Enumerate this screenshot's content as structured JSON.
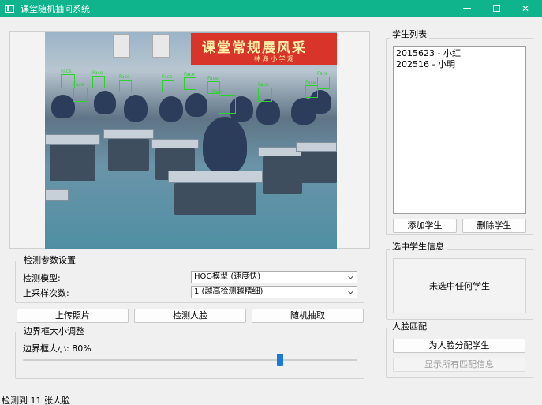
{
  "window": {
    "title": "课堂随机抽问系统",
    "accent": "#10b48c"
  },
  "image_banner": {
    "title": "课堂常规展风采",
    "subtitle": "林 海 小 学 观"
  },
  "face_label": "Face",
  "params": {
    "group_title": "检测参数设置",
    "model_label": "检测模型:",
    "model_value": "HOG模型 (速度快)",
    "upsample_label": "上采样次数:",
    "upsample_value": "1 (越高检测越精细)"
  },
  "actions": {
    "upload": "上传照片",
    "detect": "检测人脸",
    "random": "随机抽取"
  },
  "bbox": {
    "group_title": "边界框大小调整",
    "size_label": "边界框大小: 80%",
    "size_value": 0.8
  },
  "students": {
    "group_title": "学生列表",
    "items": [
      "2015623 - 小红",
      "202516 - 小明"
    ],
    "add": "添加学生",
    "remove": "删除学生"
  },
  "selected": {
    "group_title": "选中学生信息",
    "empty_text": "未选中任何学生"
  },
  "match": {
    "group_title": "人脸匹配",
    "assign": "为人脸分配学生",
    "show_all": "显示所有匹配信息"
  },
  "status_text": "检测到 11 张人脸"
}
